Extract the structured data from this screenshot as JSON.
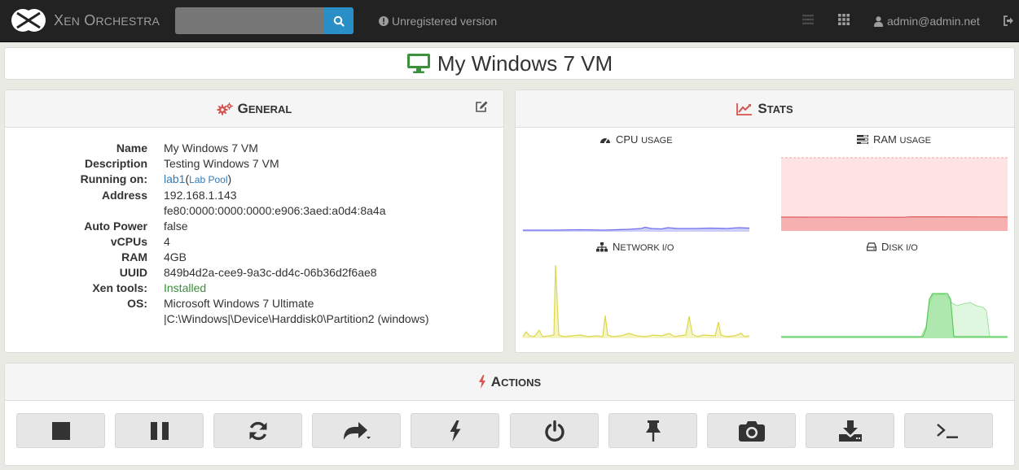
{
  "app": {
    "brand_first_x": "X",
    "brand_rest_x": "EN",
    "brand_first_o": "O",
    "brand_rest_o": "RCHESTRA"
  },
  "search": {
    "placeholder": "",
    "value": ""
  },
  "notice": "Unregistered version",
  "user": "admin@admin.net",
  "vm": {
    "title": "My Windows 7 VM"
  },
  "general": {
    "heading_first": "G",
    "heading_rest": "ENERAL",
    "properties": [
      {
        "key": "Name",
        "value": "My Windows 7 VM"
      },
      {
        "key": "Description",
        "value": "Testing Windows 7 VM"
      },
      {
        "key": "Running on:",
        "host": "lab1",
        "pool": "Lab Pool"
      },
      {
        "key": "Address",
        "value": "192.168.1.143",
        "value2": "fe80:0000:0000:0000:e906:3aed:a0d4:8a4a"
      },
      {
        "key": "Auto Power",
        "value": "false"
      },
      {
        "key": "vCPUs",
        "value": "4"
      },
      {
        "key": "RAM",
        "value": "4GB"
      },
      {
        "key": "UUID",
        "value": "849b4d2a-cee9-9a3c-dd4c-06b36d2f6ae8"
      },
      {
        "key": "Xen tools:",
        "value": "Installed"
      },
      {
        "key": "OS:",
        "value": "Microsoft Windows 7 Ultimate",
        "value2": "|C:\\Windows|\\Device\\Harddisk0\\Partition2 (windows)"
      }
    ]
  },
  "stats": {
    "heading_first": "S",
    "heading_rest": "TATS",
    "charts": [
      {
        "label_first": "CPU ",
        "label_rest": "USAGE",
        "icon": "dashboard-icon",
        "color": "#6f6ff0"
      },
      {
        "label_first": "RAM ",
        "label_rest": "USAGE",
        "icon": "tasks-icon",
        "color": "#f26a6a"
      },
      {
        "label_first": "N",
        "label_rest": "ETWORK I/O",
        "icon": "sitemap-icon",
        "color": "#e3e05a"
      },
      {
        "label_first": "D",
        "label_rest": "ISK I/O",
        "icon": "hdd-icon",
        "color": "#7fda7f"
      }
    ]
  },
  "actions": {
    "heading_first": "A",
    "heading_rest": "CTIONS",
    "buttons": [
      "stop-icon",
      "pause-icon",
      "refresh-icon",
      "share-icon",
      "bolt-icon",
      "power-icon",
      "pin-icon",
      "camera-icon",
      "download-icon",
      "console-icon"
    ]
  },
  "colors": {
    "navbar": "#222222",
    "accent": "#2a8fc7",
    "title_icon": "#3c8f3c",
    "general_icon": "#d9534f",
    "stats_icon": "#d9534f"
  }
}
